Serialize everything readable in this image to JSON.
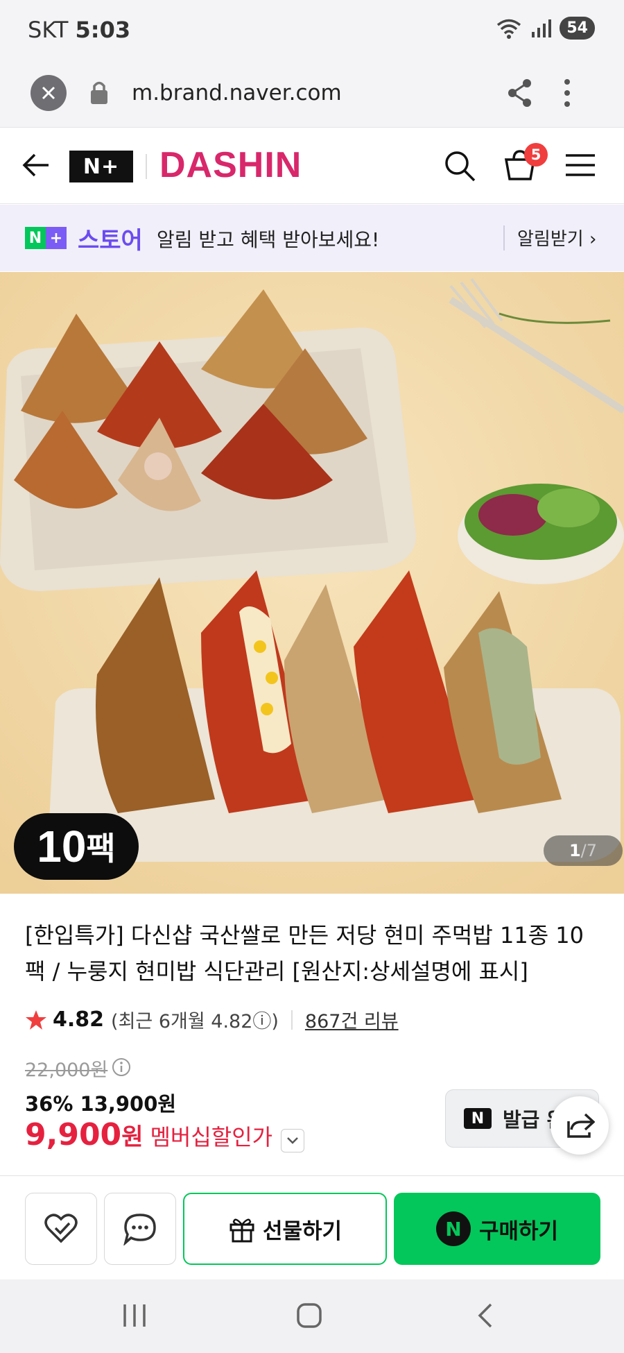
{
  "status_bar": {
    "carrier": "SKT",
    "time": "5:03",
    "battery": "54"
  },
  "browser": {
    "url": "m.brand.naver.com"
  },
  "brand_header": {
    "logo_box": "N+",
    "brand_name": "DASHIN",
    "cart_count": "5"
  },
  "notice": {
    "store_label": "스토어",
    "message": "알림 받고 혜택 받아보세요!",
    "button": "알림받기 ›"
  },
  "hero": {
    "badge_number": "10",
    "badge_unit": "팩",
    "counter_current": "1",
    "counter_total": "/7"
  },
  "product": {
    "title": "[한입특가] 다신샵 국산쌀로 만든 저당 현미 주먹밥 11종 10팩 / 누룽지 현미밥 식단관리 [원산지:상세설명에 표시]",
    "rating_score": "4.82",
    "rating_detail": "(최근 6개월 4.82ⓘ)",
    "review_count": "867건 리뷰",
    "original_price": "22,000원",
    "discount_line": "36% 13,900원",
    "member_price": "9,900",
    "member_won": "원",
    "member_label": "멤버십할인가",
    "coupon_label": "발급 완"
  },
  "action_bar": {
    "gift_label": "선물하기",
    "buy_label": "구매하기"
  },
  "colors": {
    "brand": "#d8276b",
    "naver_green": "#03c75a",
    "price_red": "#e5213f",
    "store_purple": "#6b4cf0"
  }
}
